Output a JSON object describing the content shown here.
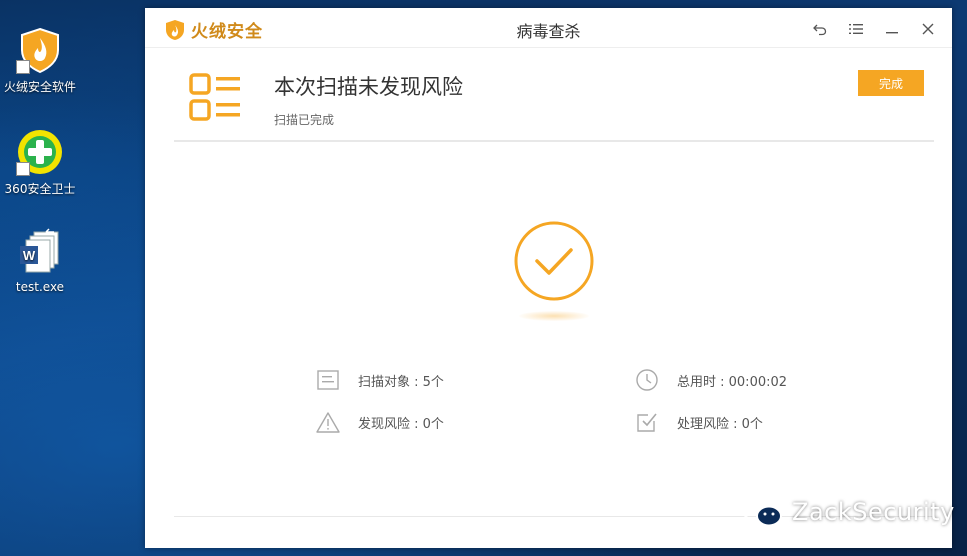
{
  "desktop": {
    "icons": [
      {
        "label": "火绒安全软件"
      },
      {
        "label": "360安全卫士"
      },
      {
        "label": "test.exe"
      }
    ]
  },
  "window": {
    "brand": "火绒安全",
    "title": "病毒查杀",
    "controls": [
      "back-icon",
      "menu-icon",
      "minimize-icon",
      "close-icon"
    ]
  },
  "result": {
    "title": "本次扫描未发现风险",
    "subtitle": "扫描已完成",
    "done_button": "完成"
  },
  "stats": {
    "scan_objects": "扫描对象 : 5个",
    "total_time": "总用时 : 00:00:02",
    "risks_found": "发现风险 : 0个",
    "risks_handled": "处理风险 : 0个"
  },
  "watermark": "ZackSecurity",
  "colors": {
    "accent": "#f5a623",
    "brand": "#d08a1a",
    "desktop": "#0b2b57"
  }
}
